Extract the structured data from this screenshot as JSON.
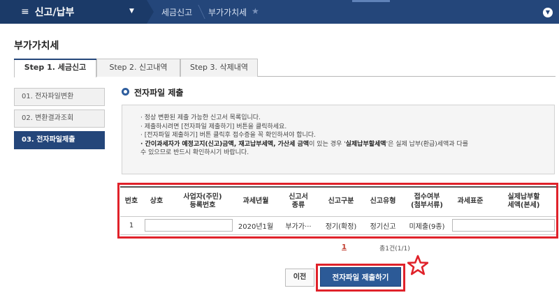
{
  "topbar": {
    "menu_label": "신고/납부",
    "crumbs": [
      "세금신고",
      "부가가치세"
    ]
  },
  "page": {
    "title": "부가가치세"
  },
  "tabs": [
    {
      "label": "Step 1. 세금신고",
      "active": true
    },
    {
      "label": "Step 2. 신고내역",
      "active": false
    },
    {
      "label": "Step 3. 삭제내역",
      "active": false
    }
  ],
  "side_nav": [
    {
      "label": "01. 전자파일변환",
      "active": false
    },
    {
      "label": "02. 변환결과조회",
      "active": false
    },
    {
      "label": "03. 전자파일제출",
      "active": true
    }
  ],
  "section": {
    "title": "전자파일 제출"
  },
  "notice": {
    "lines": [
      "· 정상 변환된 제출 가능한 신고서 목록입니다.",
      "· 제출하시려면 [전자파일 제출하기] 버튼을 클릭하세요.",
      "· [전자파일 제출하기] 버튼 클릭후 접수증을 꼭 확인하셔야 합니다."
    ],
    "bold_prefix": "· 간이과세자가 예정고지(신고)금액, 재고납부세액, 가산세 금액",
    "mid": "이 있는 경우 '",
    "bold_mid": "실제납부할세액",
    "suffix": "'은 실제 납부(환급)세액과 다를",
    "line2": "수 있으므로 반드시 확인하시기 바랍니다."
  },
  "table": {
    "headers": [
      "번호",
      "상호",
      "사업자(주민)\n등록번호",
      "과세년월",
      "신고서\n종류",
      "신고구분",
      "신고유형",
      "접수여부\n(첨부서류)",
      "과세표준",
      "실제납부할\n세액(본세)"
    ],
    "rows": [
      [
        "1",
        "",
        "",
        "2020년1월",
        "부가가···",
        "정기(확정)",
        "정기신고",
        "미제출(9종)",
        "",
        ""
      ]
    ]
  },
  "pager": {
    "current": "1",
    "total": "총1건(1/1)"
  },
  "buttons": {
    "prev": "이전",
    "submit": "전자파일 제출하기"
  },
  "colors": {
    "navy": "#24467a",
    "highlight": "#e0222a",
    "submit": "#2c5a97"
  }
}
